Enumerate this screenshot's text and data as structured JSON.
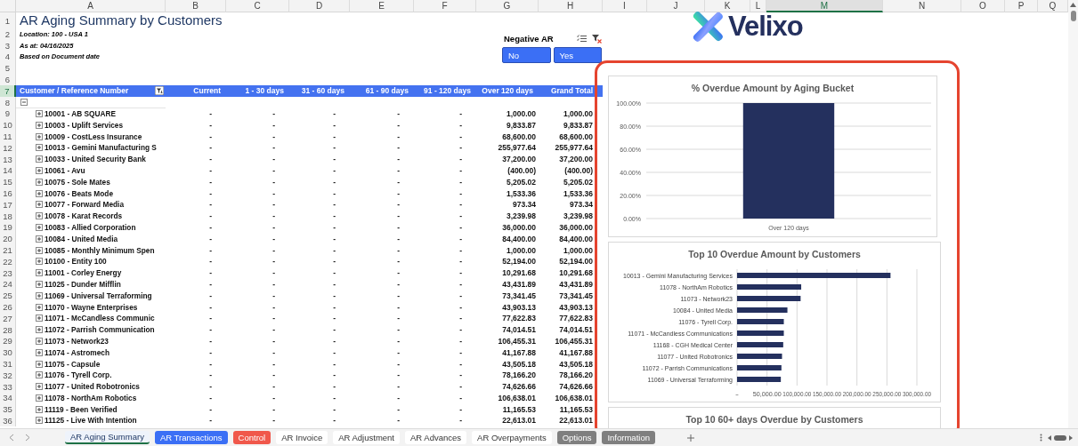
{
  "column_headers": [
    {
      "label": "A",
      "selected": false
    },
    {
      "label": "B",
      "selected": false
    },
    {
      "label": "C",
      "selected": false
    },
    {
      "label": "D",
      "selected": false
    },
    {
      "label": "E",
      "selected": false
    },
    {
      "label": "F",
      "selected": false
    },
    {
      "label": "G",
      "selected": false
    },
    {
      "label": "H",
      "selected": false
    },
    {
      "label": "I",
      "selected": false
    },
    {
      "label": "J",
      "selected": false
    },
    {
      "label": "K",
      "selected": false
    },
    {
      "label": "L",
      "selected": false
    },
    {
      "label": "M",
      "selected": true
    },
    {
      "label": "N",
      "selected": false
    },
    {
      "label": "O",
      "selected": false
    },
    {
      "label": "P",
      "selected": false
    },
    {
      "label": "Q",
      "selected": false
    }
  ],
  "row_headers": [
    {
      "label": "1",
      "selected": false
    },
    {
      "label": "2",
      "selected": false
    },
    {
      "label": "3",
      "selected": false
    },
    {
      "label": "4",
      "selected": false
    },
    {
      "label": "5",
      "selected": false
    },
    {
      "label": "6",
      "selected": false
    },
    {
      "label": "7",
      "selected": true
    },
    {
      "label": "8",
      "selected": false
    },
    {
      "label": "9",
      "selected": false
    },
    {
      "label": "10",
      "selected": false
    },
    {
      "label": "11",
      "selected": false
    },
    {
      "label": "12",
      "selected": false
    },
    {
      "label": "13",
      "selected": false
    },
    {
      "label": "14",
      "selected": false
    },
    {
      "label": "15",
      "selected": false
    },
    {
      "label": "16",
      "selected": false
    },
    {
      "label": "17",
      "selected": false
    },
    {
      "label": "18",
      "selected": false
    },
    {
      "label": "19",
      "selected": false
    },
    {
      "label": "20",
      "selected": false
    },
    {
      "label": "21",
      "selected": false
    },
    {
      "label": "22",
      "selected": false
    },
    {
      "label": "23",
      "selected": false
    },
    {
      "label": "24",
      "selected": false
    },
    {
      "label": "25",
      "selected": false
    },
    {
      "label": "26",
      "selected": false
    },
    {
      "label": "27",
      "selected": false
    },
    {
      "label": "28",
      "selected": false
    },
    {
      "label": "29",
      "selected": false
    },
    {
      "label": "30",
      "selected": false
    },
    {
      "label": "31",
      "selected": false
    },
    {
      "label": "32",
      "selected": false
    },
    {
      "label": "33",
      "selected": false
    },
    {
      "label": "34",
      "selected": false
    },
    {
      "label": "35",
      "selected": false
    },
    {
      "label": "36",
      "selected": false
    }
  ],
  "report": {
    "title": "AR Aging Summary by Customers",
    "details": [
      "Location: 100 - USA 1",
      "As at: 04/16/2025",
      "Based on Document date"
    ]
  },
  "slicer": {
    "title": "Negative AR",
    "options": [
      "No",
      "Yes"
    ]
  },
  "logo": {
    "text": "Velixo"
  },
  "table": {
    "columns": [
      "Customer / Reference Number",
      "Current",
      "1 - 30 days",
      "31 - 60 days",
      "61 - 90 days",
      "91 - 120 days",
      "Over 120 days",
      "Grand Total"
    ],
    "group_row": {
      "expanded": true
    },
    "rows": [
      {
        "customer": "10001 - AB SQUARE",
        "values": [
          "-",
          "-",
          "-",
          "-",
          "-",
          "1,000.00",
          "1,000.00"
        ]
      },
      {
        "customer": "10003 - Uplift Services",
        "values": [
          "-",
          "-",
          "-",
          "-",
          "-",
          "9,833.87",
          "9,833.87"
        ]
      },
      {
        "customer": "10009 - CostLess Insurance",
        "values": [
          "-",
          "-",
          "-",
          "-",
          "-",
          "68,600.00",
          "68,600.00"
        ]
      },
      {
        "customer": "10013 - Gemini Manufacturing S",
        "values": [
          "-",
          "-",
          "-",
          "-",
          "-",
          "255,977.64",
          "255,977.64"
        ]
      },
      {
        "customer": "10033 - United Security Bank",
        "values": [
          "-",
          "-",
          "-",
          "-",
          "-",
          "37,200.00",
          "37,200.00"
        ]
      },
      {
        "customer": "10061 - Avu",
        "values": [
          "-",
          "-",
          "-",
          "-",
          "-",
          "(400.00)",
          "(400.00)"
        ]
      },
      {
        "customer": "10075 - Sole Mates",
        "values": [
          "-",
          "-",
          "-",
          "-",
          "-",
          "5,205.02",
          "5,205.02"
        ]
      },
      {
        "customer": "10076 - Beats Mode",
        "values": [
          "-",
          "-",
          "-",
          "-",
          "-",
          "1,533.36",
          "1,533.36"
        ]
      },
      {
        "customer": "10077 - Forward Media",
        "values": [
          "-",
          "-",
          "-",
          "-",
          "-",
          "973.34",
          "973.34"
        ]
      },
      {
        "customer": "10078 - Karat Records",
        "values": [
          "-",
          "-",
          "-",
          "-",
          "-",
          "3,239.98",
          "3,239.98"
        ]
      },
      {
        "customer": "10083 - Allied Corporation",
        "values": [
          "-",
          "-",
          "-",
          "-",
          "-",
          "36,000.00",
          "36,000.00"
        ]
      },
      {
        "customer": "10084 - United Media",
        "values": [
          "-",
          "-",
          "-",
          "-",
          "-",
          "84,400.00",
          "84,400.00"
        ]
      },
      {
        "customer": "10085 - Monthly Minimum Spen",
        "values": [
          "-",
          "-",
          "-",
          "-",
          "-",
          "1,000.00",
          "1,000.00"
        ]
      },
      {
        "customer": "10100 - Entity 100",
        "values": [
          "-",
          "-",
          "-",
          "-",
          "-",
          "52,194.00",
          "52,194.00"
        ]
      },
      {
        "customer": "11001 - Corley Energy",
        "values": [
          "-",
          "-",
          "-",
          "-",
          "-",
          "10,291.68",
          "10,291.68"
        ]
      },
      {
        "customer": "11025 - Dunder Mifflin",
        "values": [
          "-",
          "-",
          "-",
          "-",
          "-",
          "43,431.89",
          "43,431.89"
        ]
      },
      {
        "customer": "11069 - Universal Terraforming",
        "values": [
          "-",
          "-",
          "-",
          "-",
          "-",
          "73,341.45",
          "73,341.45"
        ]
      },
      {
        "customer": "11070 - Wayne Enterprises",
        "values": [
          "-",
          "-",
          "-",
          "-",
          "-",
          "43,903.13",
          "43,903.13"
        ]
      },
      {
        "customer": "11071 - McCandless Communic",
        "values": [
          "-",
          "-",
          "-",
          "-",
          "-",
          "77,622.83",
          "77,622.83"
        ]
      },
      {
        "customer": "11072 - Parrish Communication",
        "values": [
          "-",
          "-",
          "-",
          "-",
          "-",
          "74,014.51",
          "74,014.51"
        ]
      },
      {
        "customer": "11073 - Network23",
        "values": [
          "-",
          "-",
          "-",
          "-",
          "-",
          "106,455.31",
          "106,455.31"
        ]
      },
      {
        "customer": "11074 - Astromech",
        "values": [
          "-",
          "-",
          "-",
          "-",
          "-",
          "41,167.88",
          "41,167.88"
        ]
      },
      {
        "customer": "11075 - Capsule",
        "values": [
          "-",
          "-",
          "-",
          "-",
          "-",
          "43,505.18",
          "43,505.18"
        ]
      },
      {
        "customer": "11076 - Tyrell Corp.",
        "values": [
          "-",
          "-",
          "-",
          "-",
          "-",
          "78,166.20",
          "78,166.20"
        ]
      },
      {
        "customer": "11077 - United Robotronics",
        "values": [
          "-",
          "-",
          "-",
          "-",
          "-",
          "74,626.66",
          "74,626.66"
        ]
      },
      {
        "customer": "11078 - NorthAm Robotics",
        "values": [
          "-",
          "-",
          "-",
          "-",
          "-",
          "106,638.01",
          "106,638.01"
        ]
      },
      {
        "customer": "11119 - Been Verified",
        "values": [
          "-",
          "-",
          "-",
          "-",
          "-",
          "11,165.53",
          "11,165.53"
        ]
      },
      {
        "customer": "11125 - Live With Intention",
        "values": [
          "-",
          "-",
          "-",
          "-",
          "-",
          "22,613.01",
          "22,613.01"
        ]
      }
    ]
  },
  "charts": [
    {
      "chart_data": {
        "type": "bar",
        "title": "% Overdue Amount by Aging Bucket",
        "categories": [
          "Over 120 days"
        ],
        "values": [
          1
        ],
        "grid": true,
        "ylim": [
          0,
          1
        ],
        "yticks": [
          {
            "value": 0,
            "label": "0.00%"
          },
          {
            "value": 0.2,
            "label": "20.00%"
          },
          {
            "value": 0.4,
            "label": "40.00%"
          },
          {
            "value": 0.6,
            "label": "60.00%"
          },
          {
            "value": 0.8,
            "label": "80.00%"
          },
          {
            "value": 1,
            "label": "100.00%"
          }
        ]
      }
    },
    {
      "chart_data": {
        "type": "bar",
        "orientation": "horizontal",
        "title": "Top 10 Overdue Amount by Customers",
        "categories": [
          "10013 - Gemini Manufacturing Services",
          "11078 - NorthAm Robotics",
          "11073 - Network23",
          "10084 - United Media",
          "11076 - Tyrell Corp.",
          "11071 - McCandless Communications",
          "11168 - CGH Medical Center",
          "11077 - United Robotronics",
          "11072 - Parrish Communications",
          "11069 - Universal Terraforming"
        ],
        "values": [
          256000,
          107000,
          106000,
          84000,
          78000,
          78000,
          77000,
          75000,
          74000,
          73000
        ],
        "grid": true,
        "xlim": [
          0,
          300000
        ],
        "xticks": [
          {
            "value": 0,
            "label": "-"
          },
          {
            "value": 50000,
            "label": "50,000.00"
          },
          {
            "value": 100000,
            "label": "100,000.00"
          },
          {
            "value": 150000,
            "label": "150,000.00"
          },
          {
            "value": 200000,
            "label": "200,000.00"
          },
          {
            "value": 250000,
            "label": "250,000.00"
          },
          {
            "value": 300000,
            "label": "300,000.00"
          }
        ]
      }
    },
    {
      "title": "Top 10 60+ days Overdue by Customers"
    }
  ],
  "sheet_tabs": [
    {
      "label": "AR Aging Summary",
      "selected": true
    },
    {
      "label": "AR Transactions",
      "selected": false,
      "color": "#3b6ff5"
    },
    {
      "label": "Control",
      "selected": false,
      "color": "#f0584b"
    },
    {
      "label": "AR Invoice",
      "selected": false
    },
    {
      "label": "AR Adjustment",
      "selected": false
    },
    {
      "label": "AR Advances",
      "selected": false
    },
    {
      "label": "AR Overpayments",
      "selected": false
    },
    {
      "label": "Options",
      "selected": false,
      "color": "#7f7f7f"
    },
    {
      "label": "Information",
      "selected": false,
      "color": "#7f7f7f"
    }
  ]
}
